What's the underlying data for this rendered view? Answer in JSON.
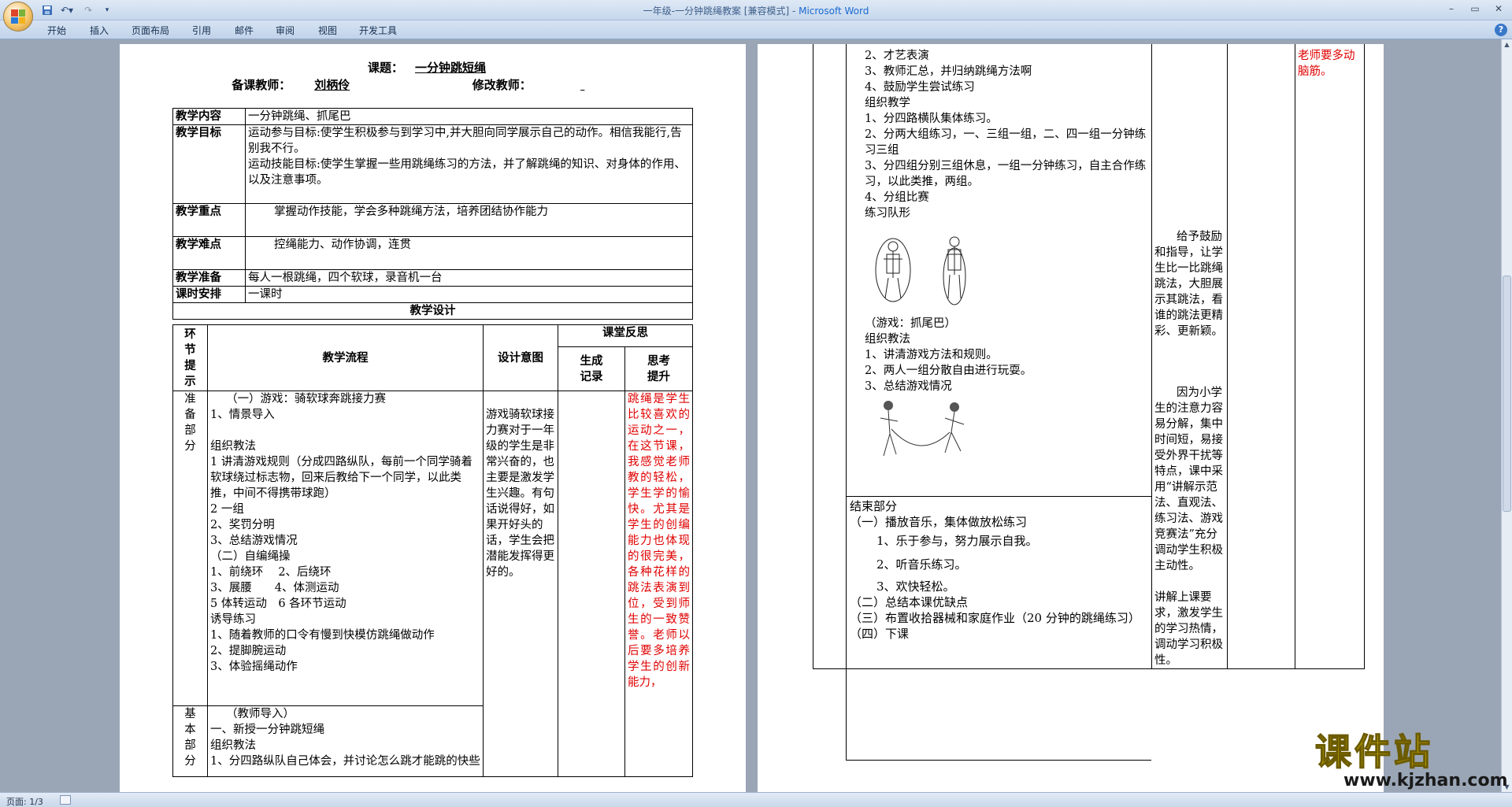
{
  "window": {
    "title_doc": "一年级-一分钟跳绳教案 [兼容模式] - ",
    "title_app": "Microsoft Word",
    "controls": [
      "–",
      "▭",
      "✕"
    ]
  },
  "ribbon": {
    "tabs": [
      "开始",
      "插入",
      "页面布局",
      "引用",
      "邮件",
      "审阅",
      "视图",
      "开发工具"
    ],
    "help": "?"
  },
  "status": {
    "page": "页面: 1/3"
  },
  "page1": {
    "title_label": "课题：",
    "title_value": "一分钟跳短绳",
    "teacher_label": "备课教师：",
    "teacher_value": "刘柄伶",
    "editor_label": "修改教师：",
    "rows": [
      {
        "label": "教学内容",
        "lines": [
          "一分钟跳绳、抓尾巴"
        ]
      },
      {
        "label": "教学目标",
        "lines": [
          "运动参与目标:使学生积极参与到学习中,并大胆向同学展示自己的动作。相信我能行,告别我不行。",
          "运动技能目标:使学生掌握一些用跳绳练习的方法，并了解跳绳的知识、对身体的作用、以及注意事项。"
        ]
      },
      {
        "label": "教学重点",
        "lines": [
          "掌握动作技能，学会多种跳绳方法，培养团结协作能力"
        ]
      },
      {
        "label": "教学难点",
        "lines": [
          "控绳能力、动作协调，连贯"
        ]
      },
      {
        "label": "教学准备",
        "lines": [
          "每人一根跳绳，四个软球，录音机一台"
        ]
      },
      {
        "label": "课时安排",
        "lines": [
          "一课时"
        ]
      }
    ],
    "design_header": "教学设计",
    "col_stage": [
      "环",
      "节",
      "提",
      "示"
    ],
    "col_flow": "教学流程",
    "col_intent": "设计意图",
    "col_reflect": "课堂反思",
    "col_record": [
      "生成",
      "记录"
    ],
    "col_improve": [
      "思考",
      "提升"
    ],
    "stage1": [
      "准",
      "备",
      "部",
      "分"
    ],
    "stage1_flow": [
      "（一）游戏：骑软球奔跳接力赛",
      "1、情景导入",
      "",
      "组织教法",
      "1 讲清游戏规则（分成四路纵队，每前一个同学骑着软球绕过标志物，回来后教给下一个同学，以此类推，中间不得携带球跑）",
      "2 一组",
      "2、奖罚分明",
      "3、总结游戏情况",
      "（二）自编绳操",
      "1、前绕环　 2、后绕环",
      "3、展腰　　4、体测运动",
      "5 体转运动　6 各环节运动",
      "诱导练习",
      "1、随着教师的口令有慢到快模仿跳绳做动作",
      "2、提脚腕运动",
      "3、体验摇绳动作"
    ],
    "stage1_intent": "游戏骑软球接力赛对于一年级的学生是非常兴奋的，也主要是激发学生兴趣。有句话说得好，如果开好头的话，学生会把潜能发挥得更好的。",
    "stage1_improve": "跳绳是学生比较喜欢的运动之一，在这节课，我感觉老师教的轻松，学生学的愉快。尤其是学生的创编能力也体现的很完美，各种花样的跳法表演到位，受到师生的一致赞誉。老师以后要多培养学生的创新能力，",
    "stage2": [
      "基",
      "本",
      "部",
      "分"
    ],
    "stage2_flow": [
      "（教师导入）",
      "一、新授一分钟跳短绳",
      "组织教法",
      "1、分四路纵队自己体会，并讨论怎么跳才能跳的快些"
    ]
  },
  "page2": {
    "flow_top": [
      "2、才艺表演",
      "3、教师汇总，并归纳跳绳方法啊",
      "4、鼓励学生尝试练习",
      "组织教学",
      "1、分四路横队集体练习。",
      "2、分两大组练习，一、三组一组，二、四一组一分钟练习三组",
      "3、分四组分别三组休息，一组一分钟练习，自主合作练习，以此类推，两组。",
      "4、分组比赛",
      "练习队形"
    ],
    "game_title": "（游戏：抓尾巴）",
    "game_lines": [
      "组织教法",
      "1、讲清游戏方法和规则。",
      "2、两人一组分散自由进行玩耍。",
      "3、总结游戏情况"
    ],
    "end_title": "结束部分",
    "end_lines": [
      "（一）播放音乐，集体做放松练习",
      "1、乐于参与，努力展示自我。",
      "2、听音乐练习。",
      "3、欢快轻松。",
      "（二）总结本课优缺点",
      "（三）布置收拾器械和家庭作业（20 分钟的跳绳练习）",
      "（四）下课"
    ],
    "intent1": "给予鼓励和指导，让学生比一比跳绳跳法，大胆展示其跳法，看谁的跳法更精彩、更新颖。",
    "intent2": "因为小学生的注意力容易分解，集中时间短，易接受外界干扰等特点，课中采用“讲解示范法、直观法、练习法、游戏竞赛法”充分调动学生积极主动性。",
    "intent3": "讲解上课要求，激发学生的学习热情，调动学习积极性。",
    "improve": "老师要多动脑筋。"
  },
  "watermark": {
    "cn": "课件站",
    "url": "www.kjzhan.com"
  },
  "colors": {
    "accent_red": "#e00000",
    "ribbon_bg": "#c1d3ea",
    "workspace": "#9aa6b6"
  }
}
